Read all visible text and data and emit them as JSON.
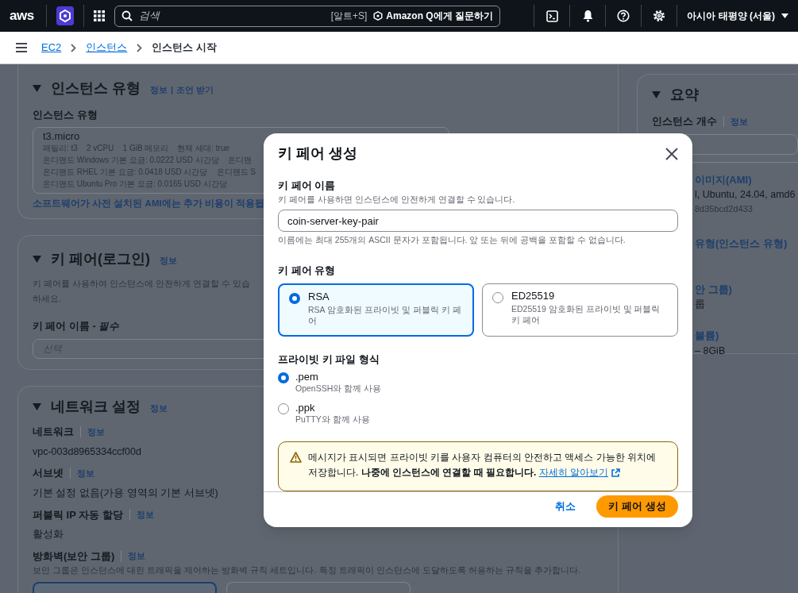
{
  "top_nav": {
    "logo": "aws",
    "search": {
      "placeholder": "검색",
      "shortcut": "[알트+S]"
    },
    "ask_q": "Amazon Q에게 질문하기",
    "region": "아시아 태평양 (서울)"
  },
  "breadcrumbs": [
    {
      "label": "EC2",
      "link": true
    },
    {
      "label": "인스턴스",
      "link": true
    },
    {
      "label": "인스턴스 시작",
      "link": false
    }
  ],
  "instance_type_panel": {
    "title": "인스턴스 유형",
    "links": [
      "정보",
      "조언 받기"
    ],
    "link_separator": "|",
    "field_label": "인스턴스 유형",
    "selected_type": {
      "name": "t3.micro",
      "lines": [
        "패밀리: t3    2 vCPU    1 GiB 메모리    현재 세대: true",
        "온디맨드 Windows 기본 요금: 0.0222 USD 시간당    온디맨",
        "온디맨드 RHEL 기본 요금: 0.0418 USD 시간당    온디맨드 S",
        "온디맨드 Ubuntu Pro 기본 요금: 0.0165 USD 시간당"
      ]
    },
    "note": "소프트웨어가 사전 설치된 AMI에는 추가 비용이 적용됩"
  },
  "key_pair_panel": {
    "title": "키 페어(로그인)",
    "info": "정보",
    "description_lines": [
      "키 페어를 사용하여 인스턴스에 안전하게 연결할 수 있습",
      "하세요."
    ],
    "field_label": "키 페어 이름 - *필수*",
    "placeholder": "선택"
  },
  "network_panel": {
    "title": "네트워크 설정",
    "info": "정보",
    "fields": [
      {
        "label": "네트워크",
        "info": "정보",
        "value": "vpc-003d8965334ccf00d"
      },
      {
        "label": "서브넷",
        "info": "정보",
        "value": "기본 설정 없음(가용 영역의 기본 서브넷)"
      },
      {
        "label": "퍼블릭 IP 자동 할당",
        "info": "정보",
        "value": "활성화"
      },
      {
        "label": "방화벽(보안 그룹)",
        "info": "정보",
        "description": "보안 그룹은 인스턴스에 대한 트래픽을 제어하는 방화벽 규칙 세트입니다. 특정 트래픽이 인스턴스에 도달하도록 허용하는 규칙을 추가합니다."
      }
    ],
    "option_tiles": [
      {
        "selected": true
      },
      {
        "selected": false
      }
    ]
  },
  "summary_panel": {
    "title": "요약",
    "count_label": "인스턴스 개수",
    "info": "정보",
    "items": [
      {
        "title": "이미지(AMI)",
        "lines": [
          "l, Ubuntu, 24.04, amd6",
          "8d35bcd2d433"
        ]
      },
      {
        "title": "유형(인스턴스 유형)"
      },
      {
        "title": "안 그룹)",
        "lines": [
          "룹"
        ]
      },
      {
        "title": "볼륨)",
        "lines": [
          "– 8GiB"
        ]
      }
    ]
  },
  "modal": {
    "title": "키 페어 생성",
    "name_field": {
      "label": "키 페어 이름",
      "description": "키 페어를 사용하면 인스턴스에 안전하게 연결할 수 있습니다.",
      "value": "coin-server-key-pair",
      "constraint": "이름에는 최대 255개의 ASCII 문자가 포함됩니다. 앞 또는 뒤에 공백을 포함할 수 없습니다."
    },
    "key_type": {
      "label": "키 페어 유형",
      "options": [
        {
          "label": "RSA",
          "description": "RSA 암호화된 프라이빗 및 퍼블릭 키 페어",
          "selected": true
        },
        {
          "label": "ED25519",
          "description": "ED25519 암호화된 프라이빗 및 퍼블릭 키 페어",
          "selected": false
        }
      ]
    },
    "file_format": {
      "label": "프라이빗 키 파일 형식",
      "options": [
        {
          "label": ".pem",
          "description": "OpenSSH와 함께 사용",
          "selected": true
        },
        {
          "label": ".ppk",
          "description": "PuTTY와 함께 사용",
          "selected": false
        }
      ]
    },
    "alert": {
      "text": "메시지가 표시되면 프라이빗 키를 사용자 컴퓨터의 안전하고 액세스 가능한 위치에 저장합니다. **나중에 인스턴스에 연결할 때 필요합니다.**",
      "link": "자세히 알아보기"
    },
    "buttons": {
      "cancel": "취소",
      "submit": "키 페어 생성"
    }
  }
}
